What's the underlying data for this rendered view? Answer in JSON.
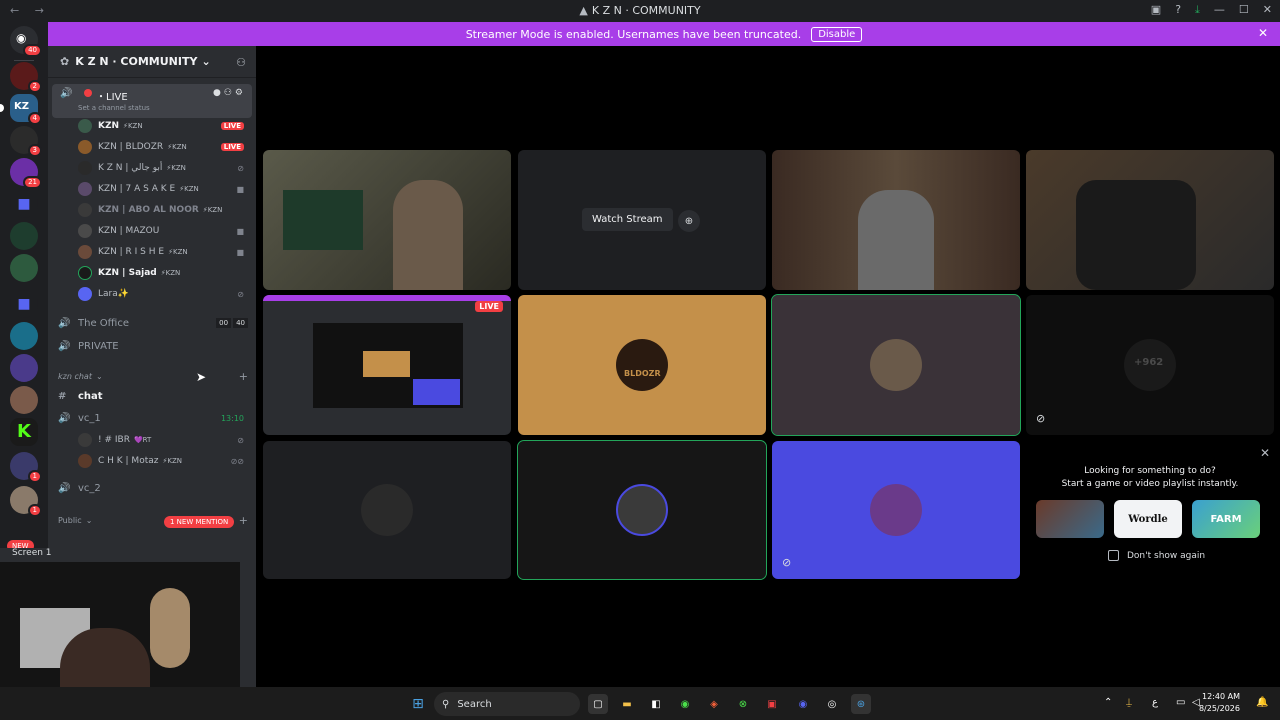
{
  "window": {
    "title": "K Z N · COMMUNITY"
  },
  "banner": {
    "text": "Streamer Mode is enabled. Usernames have been truncated.",
    "button": "Disable"
  },
  "server_rail": {
    "home_badge": "40",
    "badges": [
      "2",
      "4",
      "3",
      "21",
      "1",
      "1"
    ],
    "new_label": "NEW"
  },
  "sidebar": {
    "server_name": "K Z N · COMMUNITY",
    "live_channel": {
      "name": "・LIVE",
      "status_placeholder": "Set a channel status"
    },
    "members": [
      {
        "name": "KZN",
        "tag": "⚡KZN",
        "badge": "LIVE"
      },
      {
        "name": "KZN | BLDOZR",
        "tag": "⚡KZN",
        "badge": "LIVE"
      },
      {
        "name": "K Z N | أبو جالي",
        "tag": "⚡KZN",
        "badge": ""
      },
      {
        "name": "KZN | 7 A S A K E",
        "tag": "⚡KZN",
        "badge": ""
      },
      {
        "name": "KZN | ABO AL NOOR",
        "tag": "⚡KZN",
        "badge": ""
      },
      {
        "name": "KZN | MAZOU",
        "tag": "",
        "badge": ""
      },
      {
        "name": "KZN | R I S H E",
        "tag": "⚡KZN",
        "badge": ""
      },
      {
        "name": "KZN | Sajad",
        "tag": "⚡KZN",
        "badge": ""
      },
      {
        "name": "Lara✨",
        "tag": "",
        "badge": ""
      }
    ],
    "office": {
      "name": "The Office",
      "count1": "00",
      "count2": "40"
    },
    "private": {
      "name": "PRIVATE"
    },
    "category1": "kzn chat",
    "chat": "chat",
    "vc1": {
      "name": "vc_1",
      "time": "13:10"
    },
    "vc1_members": [
      {
        "name": "! # IBR",
        "tag": "💜RT"
      },
      {
        "name": "C H K | Motaz",
        "tag": "⚡KZN"
      }
    ],
    "vc2": "vc_2",
    "category2": "Public",
    "mention": "1 NEW MENTION",
    "screen_label": "Screen 1"
  },
  "stage": {
    "watch_stream": "Watch Stream",
    "live_badge": "LIVE",
    "tile_text_962": "+962",
    "bldozr_text": "BLDOZR",
    "activity": {
      "line1": "Looking for something to do?",
      "line2": "Start a game or video playlist instantly.",
      "games": [
        "",
        "Wordle",
        "FARM"
      ],
      "dont_show": "Don't show again"
    }
  },
  "taskbar": {
    "search": "Search",
    "time": "12:40 AM",
    "date": "8/25/2026"
  }
}
